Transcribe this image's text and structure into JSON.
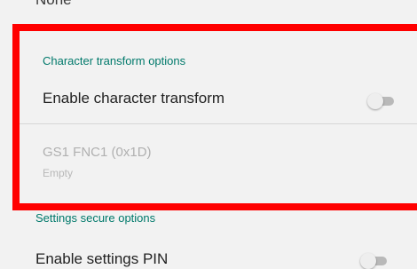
{
  "previous_value": "None",
  "character_transform": {
    "section_title": "Character transform options",
    "enable_label": "Enable character transform",
    "enable_state": false,
    "gs1_title": "GS1 FNC1 (0x1D)",
    "gs1_value": "Empty"
  },
  "settings_secure": {
    "section_title": "Settings secure options",
    "enable_pin_label": "Enable settings PIN",
    "enable_pin_state": false
  },
  "colors": {
    "accent": "#00796b",
    "highlight_border": "#ff0000",
    "background": "#f2f2f2"
  }
}
